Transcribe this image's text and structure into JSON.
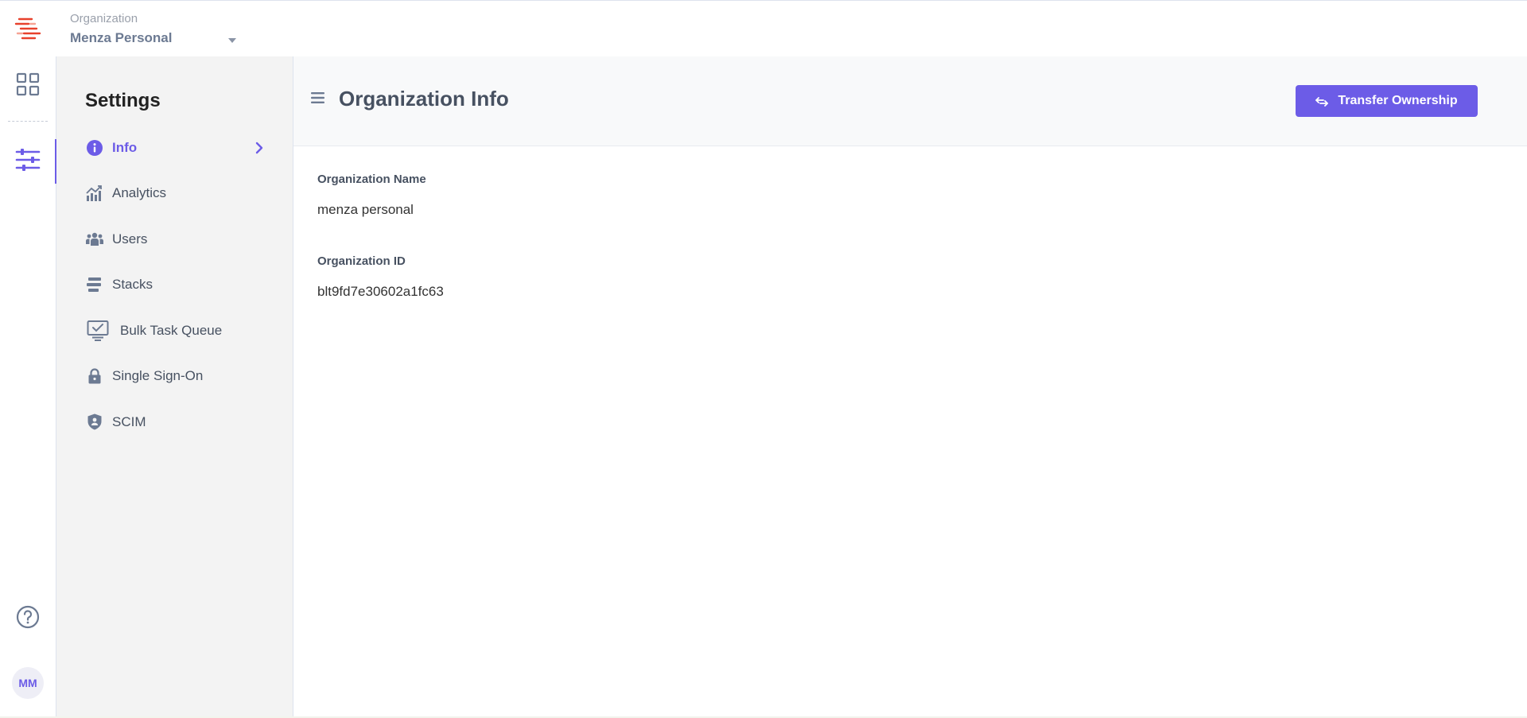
{
  "header": {
    "org_label": "Organization",
    "org_name": "Menza Personal"
  },
  "rail": {
    "icons": [
      "logo-icon",
      "dashboard-grid-icon",
      "settings-sliders-icon",
      "help-icon"
    ],
    "avatar_initials": "MM"
  },
  "sidebar": {
    "title": "Settings",
    "items": [
      {
        "label": "Info",
        "icon": "info-icon",
        "active": true
      },
      {
        "label": "Analytics",
        "icon": "analytics-icon"
      },
      {
        "label": "Users",
        "icon": "users-icon"
      },
      {
        "label": "Stacks",
        "icon": "stacks-icon"
      },
      {
        "label": "Bulk Task Queue",
        "icon": "bulk-task-queue-icon"
      },
      {
        "label": "Single Sign-On",
        "icon": "lock-icon"
      },
      {
        "label": "SCIM",
        "icon": "shield-icon"
      }
    ]
  },
  "main": {
    "title": "Organization Info",
    "transfer_button_label": "Transfer Ownership",
    "fields": [
      {
        "label": "Organization Name",
        "value": "menza personal"
      },
      {
        "label": "Organization ID",
        "value": "blt9fd7e30602a1fc63"
      }
    ]
  },
  "colors": {
    "accent": "#6c5ce7",
    "logo": "#e8412c",
    "nav_text": "#475161",
    "sidebar_bg": "#f3f3f3"
  }
}
